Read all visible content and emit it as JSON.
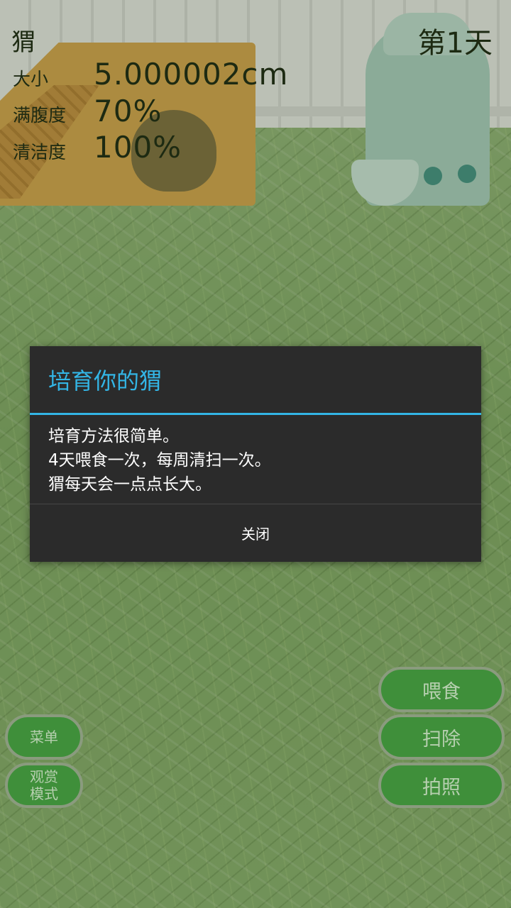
{
  "hud": {
    "pet_name": "猬",
    "day": "第1天",
    "stats": [
      {
        "label": "大小",
        "value": "5.000002cm"
      },
      {
        "label": "满腹度",
        "value": "70%"
      },
      {
        "label": "清洁度",
        "value": "100%"
      }
    ]
  },
  "dialog": {
    "title": "培育你的猬",
    "lines": [
      "培育方法很简单。",
      "4天喂食一次，每周清扫一次。",
      "猬每天会一点点长大。"
    ],
    "close_label": "关闭"
  },
  "buttons": {
    "feed": "喂食",
    "clean": "扫除",
    "photo": "拍照",
    "menu": "菜单",
    "view_mode_line1": "观赏",
    "view_mode_line2": "模式"
  },
  "colors": {
    "accent": "#33b5e5",
    "dialog_bg": "#2b2b2b",
    "button_bg": "#3f8f3a",
    "grass": "#7fa86a"
  }
}
